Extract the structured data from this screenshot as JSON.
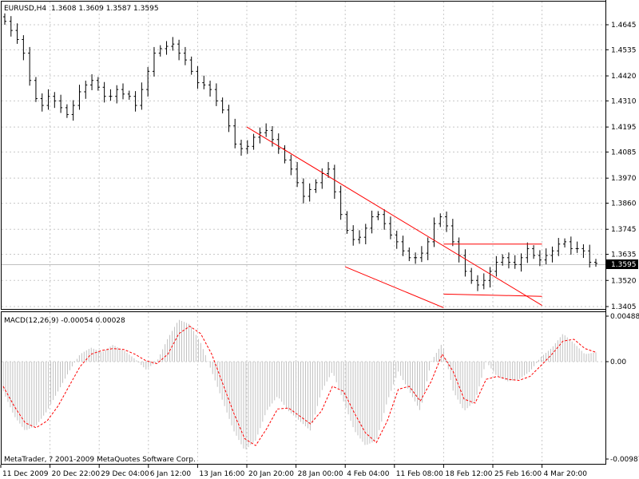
{
  "main_chart": {
    "symbol_label": "EURUSD,H4",
    "ohlc_label": "1.3608 1.3609 1.3587 1.3595",
    "current_price": "1.3595",
    "price_ticks": [
      "1.4645",
      "1.4535",
      "1.4420",
      "1.4310",
      "1.4195",
      "1.4085",
      "1.3970",
      "1.3860",
      "1.3745",
      "1.3635",
      "1.3520",
      "1.3405"
    ]
  },
  "indicator": {
    "label": "MACD(12,26,9) -0.00054 0.00028",
    "scale_ticks": [
      "0.00488",
      "0.00",
      "-0.00987"
    ]
  },
  "copyright": "MetaTrader, ? 2001-2009 MetaQuotes Software Corp.",
  "time_ticks": [
    "11 Dec 2009",
    "20 Dec 22:00",
    "29 Dec 04:00",
    "6 Jan 12:00",
    "13 Jan 16:00",
    "20 Jan 20:00",
    "28 Jan 00:00",
    "4 Feb 04:00",
    "11 Feb 08:00",
    "18 Feb 12:00",
    "25 Feb 16:00",
    "4 Mar 20:00"
  ],
  "chart_data": [
    {
      "type": "candlestick",
      "title": "EURUSD,H4",
      "ylim": [
        1.3405,
        1.4645
      ],
      "colors": {
        "bars": "#000000",
        "trendlines": "#ff0000",
        "grid": "#c8c8c8"
      },
      "last_bar": {
        "open": 1.3608,
        "high": 1.3609,
        "low": 1.3587,
        "close": 1.3595
      },
      "series": [
        {
          "name": "EURUSD,H4",
          "values": [
            1.466,
            1.462,
            1.458,
            1.452,
            1.44,
            1.432,
            1.429,
            1.433,
            1.431,
            1.428,
            1.425,
            1.429,
            1.435,
            1.438,
            1.44,
            1.437,
            1.433,
            1.433,
            1.436,
            1.434,
            1.433,
            1.429,
            1.436,
            1.444,
            1.452,
            1.454,
            1.455,
            1.456,
            1.452,
            1.449,
            1.444,
            1.439,
            1.438,
            1.436,
            1.431,
            1.427,
            1.42,
            1.412,
            1.41,
            1.411,
            1.415,
            1.417,
            1.418,
            1.414,
            1.41,
            1.405,
            1.401,
            1.395,
            1.389,
            1.392,
            1.395,
            1.399,
            1.401,
            1.391,
            1.381,
            1.374,
            1.37,
            1.371,
            1.375,
            1.38,
            1.381,
            1.377,
            1.372,
            1.369,
            1.365,
            1.362,
            1.362,
            1.364,
            1.369,
            1.377,
            1.38,
            1.376,
            1.369,
            1.363,
            1.356,
            1.352,
            1.35,
            1.352,
            1.356,
            1.36,
            1.362,
            1.36,
            1.359,
            1.362,
            1.366,
            1.363,
            1.361,
            1.363,
            1.365,
            1.368,
            1.369,
            1.366,
            1.366,
            1.365,
            1.36,
            1.3595
          ]
        }
      ],
      "trendlines": [
        {
          "from": {
            "x": "20 Jan 20:00",
            "y": 1.4195
          },
          "to": {
            "x": "4 Mar 20:00",
            "y": 1.341
          }
        },
        {
          "from": {
            "x": "4 Feb 04:00",
            "y": 1.358
          },
          "to": {
            "x": "18 Feb 12:00",
            "y": 1.34
          }
        },
        {
          "from": {
            "x": "18 Feb 12:00",
            "y": 1.368
          },
          "to": {
            "x": "4 Mar 20:00",
            "y": 1.368
          }
        },
        {
          "from": {
            "x": "18 Feb 12:00",
            "y": 1.346
          },
          "to": {
            "x": "4 Mar 20:00",
            "y": 1.345
          }
        }
      ]
    },
    {
      "type": "area",
      "title": "MACD(12,26,9)",
      "ylim": [
        -0.00987,
        0.00488
      ],
      "colors": {
        "histogram": "#c0c0c0",
        "signal": "#ff0000"
      },
      "series": [
        {
          "name": "MACD",
          "values": [
            -0.003,
            -0.0055,
            -0.007,
            -0.0065,
            -0.005,
            -0.003,
            -0.001,
            0.0008,
            0.0015,
            0.001,
            0.0018,
            0.0012,
            0.0003,
            -0.0008,
            0.0,
            0.0025,
            0.0045,
            0.004,
            0.002,
            -0.001,
            -0.004,
            -0.007,
            -0.009,
            -0.008,
            -0.005,
            -0.0035,
            -0.005,
            -0.006,
            -0.007,
            -0.003,
            -0.001,
            -0.004,
            -0.007,
            -0.0085,
            -0.008,
            -0.004,
            -0.001,
            -0.003,
            -0.005,
            0.0,
            0.002,
            -0.003,
            -0.005,
            -0.004,
            0.0,
            -0.0015,
            -0.002,
            -0.0018,
            -0.001,
            0.0005,
            0.0015,
            0.003,
            0.002,
            0.0008,
            0.001
          ]
        },
        {
          "name": "Signal",
          "values": [
            -0.0025,
            -0.0045,
            -0.0062,
            -0.0067,
            -0.006,
            -0.0045,
            -0.0025,
            -0.0005,
            0.0008,
            0.0012,
            0.0014,
            0.0013,
            0.0008,
            0.0001,
            -0.0002,
            0.0008,
            0.003,
            0.0038,
            0.003,
            0.0008,
            -0.0022,
            -0.0052,
            -0.0078,
            -0.0085,
            -0.0068,
            -0.0048,
            -0.0047,
            -0.0055,
            -0.0063,
            -0.005,
            -0.0025,
            -0.003,
            -0.0052,
            -0.0072,
            -0.0082,
            -0.006,
            -0.0028,
            -0.0025,
            -0.004,
            -0.002,
            0.0008,
            -0.001,
            -0.0038,
            -0.0042,
            -0.0018,
            -0.0015,
            -0.0018,
            -0.0019,
            -0.0015,
            -0.0004,
            0.0008,
            0.0022,
            0.0024,
            0.0014,
            0.001
          ]
        }
      ]
    }
  ]
}
